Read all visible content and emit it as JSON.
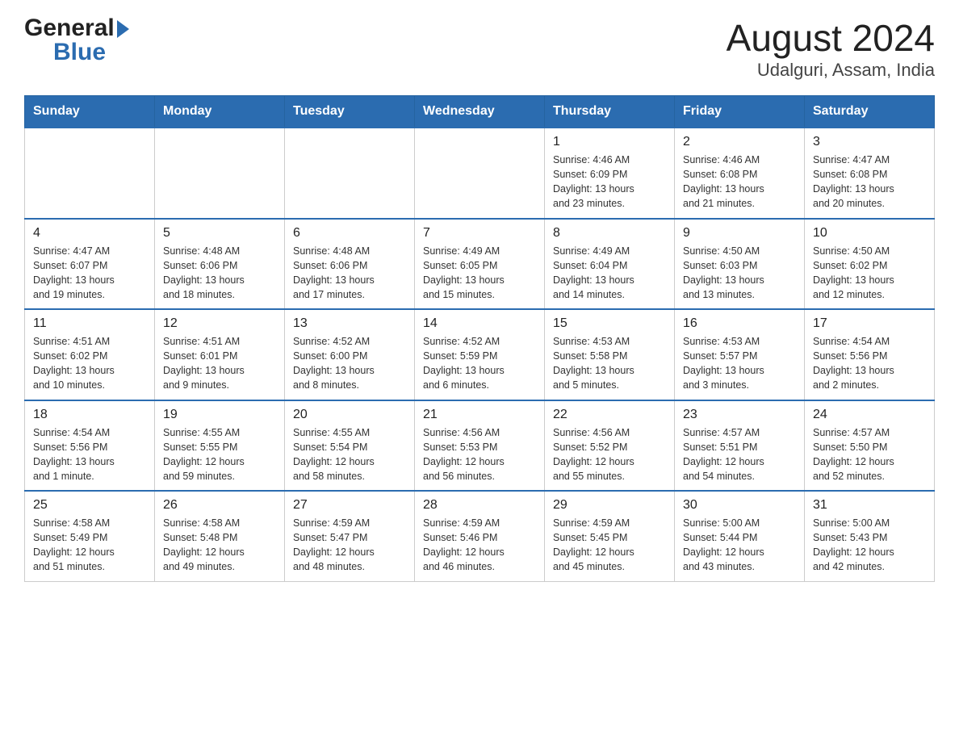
{
  "header": {
    "title": "August 2024",
    "subtitle": "Udalguri, Assam, India"
  },
  "days_of_week": [
    "Sunday",
    "Monday",
    "Tuesday",
    "Wednesday",
    "Thursday",
    "Friday",
    "Saturday"
  ],
  "weeks": [
    [
      {
        "day": "",
        "info": ""
      },
      {
        "day": "",
        "info": ""
      },
      {
        "day": "",
        "info": ""
      },
      {
        "day": "",
        "info": ""
      },
      {
        "day": "1",
        "info": "Sunrise: 4:46 AM\nSunset: 6:09 PM\nDaylight: 13 hours\nand 23 minutes."
      },
      {
        "day": "2",
        "info": "Sunrise: 4:46 AM\nSunset: 6:08 PM\nDaylight: 13 hours\nand 21 minutes."
      },
      {
        "day": "3",
        "info": "Sunrise: 4:47 AM\nSunset: 6:08 PM\nDaylight: 13 hours\nand 20 minutes."
      }
    ],
    [
      {
        "day": "4",
        "info": "Sunrise: 4:47 AM\nSunset: 6:07 PM\nDaylight: 13 hours\nand 19 minutes."
      },
      {
        "day": "5",
        "info": "Sunrise: 4:48 AM\nSunset: 6:06 PM\nDaylight: 13 hours\nand 18 minutes."
      },
      {
        "day": "6",
        "info": "Sunrise: 4:48 AM\nSunset: 6:06 PM\nDaylight: 13 hours\nand 17 minutes."
      },
      {
        "day": "7",
        "info": "Sunrise: 4:49 AM\nSunset: 6:05 PM\nDaylight: 13 hours\nand 15 minutes."
      },
      {
        "day": "8",
        "info": "Sunrise: 4:49 AM\nSunset: 6:04 PM\nDaylight: 13 hours\nand 14 minutes."
      },
      {
        "day": "9",
        "info": "Sunrise: 4:50 AM\nSunset: 6:03 PM\nDaylight: 13 hours\nand 13 minutes."
      },
      {
        "day": "10",
        "info": "Sunrise: 4:50 AM\nSunset: 6:02 PM\nDaylight: 13 hours\nand 12 minutes."
      }
    ],
    [
      {
        "day": "11",
        "info": "Sunrise: 4:51 AM\nSunset: 6:02 PM\nDaylight: 13 hours\nand 10 minutes."
      },
      {
        "day": "12",
        "info": "Sunrise: 4:51 AM\nSunset: 6:01 PM\nDaylight: 13 hours\nand 9 minutes."
      },
      {
        "day": "13",
        "info": "Sunrise: 4:52 AM\nSunset: 6:00 PM\nDaylight: 13 hours\nand 8 minutes."
      },
      {
        "day": "14",
        "info": "Sunrise: 4:52 AM\nSunset: 5:59 PM\nDaylight: 13 hours\nand 6 minutes."
      },
      {
        "day": "15",
        "info": "Sunrise: 4:53 AM\nSunset: 5:58 PM\nDaylight: 13 hours\nand 5 minutes."
      },
      {
        "day": "16",
        "info": "Sunrise: 4:53 AM\nSunset: 5:57 PM\nDaylight: 13 hours\nand 3 minutes."
      },
      {
        "day": "17",
        "info": "Sunrise: 4:54 AM\nSunset: 5:56 PM\nDaylight: 13 hours\nand 2 minutes."
      }
    ],
    [
      {
        "day": "18",
        "info": "Sunrise: 4:54 AM\nSunset: 5:56 PM\nDaylight: 13 hours\nand 1 minute."
      },
      {
        "day": "19",
        "info": "Sunrise: 4:55 AM\nSunset: 5:55 PM\nDaylight: 12 hours\nand 59 minutes."
      },
      {
        "day": "20",
        "info": "Sunrise: 4:55 AM\nSunset: 5:54 PM\nDaylight: 12 hours\nand 58 minutes."
      },
      {
        "day": "21",
        "info": "Sunrise: 4:56 AM\nSunset: 5:53 PM\nDaylight: 12 hours\nand 56 minutes."
      },
      {
        "day": "22",
        "info": "Sunrise: 4:56 AM\nSunset: 5:52 PM\nDaylight: 12 hours\nand 55 minutes."
      },
      {
        "day": "23",
        "info": "Sunrise: 4:57 AM\nSunset: 5:51 PM\nDaylight: 12 hours\nand 54 minutes."
      },
      {
        "day": "24",
        "info": "Sunrise: 4:57 AM\nSunset: 5:50 PM\nDaylight: 12 hours\nand 52 minutes."
      }
    ],
    [
      {
        "day": "25",
        "info": "Sunrise: 4:58 AM\nSunset: 5:49 PM\nDaylight: 12 hours\nand 51 minutes."
      },
      {
        "day": "26",
        "info": "Sunrise: 4:58 AM\nSunset: 5:48 PM\nDaylight: 12 hours\nand 49 minutes."
      },
      {
        "day": "27",
        "info": "Sunrise: 4:59 AM\nSunset: 5:47 PM\nDaylight: 12 hours\nand 48 minutes."
      },
      {
        "day": "28",
        "info": "Sunrise: 4:59 AM\nSunset: 5:46 PM\nDaylight: 12 hours\nand 46 minutes."
      },
      {
        "day": "29",
        "info": "Sunrise: 4:59 AM\nSunset: 5:45 PM\nDaylight: 12 hours\nand 45 minutes."
      },
      {
        "day": "30",
        "info": "Sunrise: 5:00 AM\nSunset: 5:44 PM\nDaylight: 12 hours\nand 43 minutes."
      },
      {
        "day": "31",
        "info": "Sunrise: 5:00 AM\nSunset: 5:43 PM\nDaylight: 12 hours\nand 42 minutes."
      }
    ]
  ],
  "logo": {
    "general": "General",
    "blue": "Blue"
  },
  "colors": {
    "header_bg": "#2b6cb0",
    "header_text": "#ffffff"
  }
}
